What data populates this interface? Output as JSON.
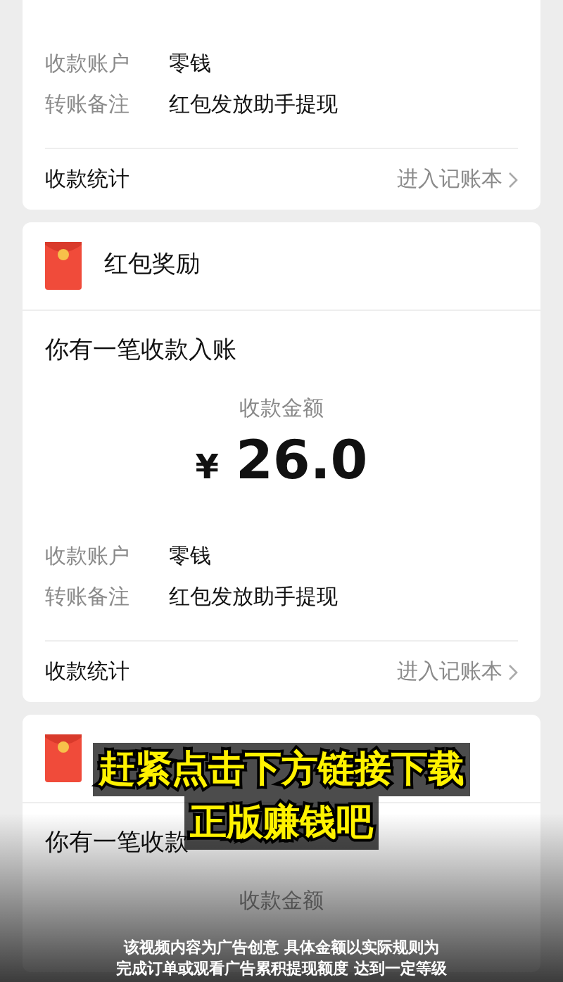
{
  "cards": [
    {
      "rows": [
        {
          "label": "收款账户",
          "value": "零钱"
        },
        {
          "label": "转账备注",
          "value": "红包发放助手提现"
        }
      ],
      "stats": {
        "label": "收款统计",
        "link": "进入记账本"
      }
    },
    {
      "title": "红包奖励",
      "intro": "你有一笔收款入账",
      "amount_label": "收款金额",
      "currency": "¥",
      "amount": "26.0",
      "rows": [
        {
          "label": "收款账户",
          "value": "零钱"
        },
        {
          "label": "转账备注",
          "value": "红包发放助手提现"
        }
      ],
      "stats": {
        "label": "收款统计",
        "link": "进入记账本"
      }
    },
    {
      "intro": "你有一笔收款",
      "amount_label": "收款金额"
    }
  ],
  "caption": [
    "赶紧点击下方链接下载",
    "正版赚钱吧"
  ],
  "disclaimer": [
    "该视频内容为广告创意 具体金额以实际规则为",
    "完成订单或观看广告累积提现额度 达到一定等级"
  ]
}
